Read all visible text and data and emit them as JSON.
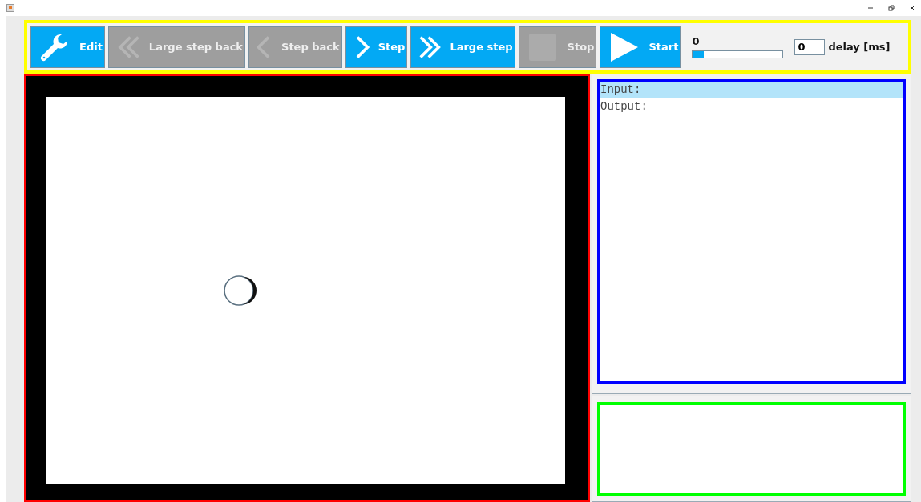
{
  "toolbar": {
    "buttons": [
      {
        "kind": "wrench",
        "label": "Edit",
        "disabled": false
      },
      {
        "kind": "double-left",
        "label": "Large step back",
        "disabled": true
      },
      {
        "kind": "left",
        "label": "Step back",
        "disabled": true
      },
      {
        "kind": "right",
        "label": "Step",
        "disabled": false
      },
      {
        "kind": "double-right",
        "label": "Large step",
        "disabled": false
      },
      {
        "kind": "square",
        "label": "Stop",
        "disabled": true
      },
      {
        "kind": "play",
        "label": "Start",
        "disabled": false
      }
    ],
    "progress": {
      "reading": "0",
      "level": 0.12
    },
    "delay": {
      "value": "0",
      "label": "delay [ms]"
    }
  },
  "io_list": [
    {
      "text": "Input:",
      "selected": true
    },
    {
      "text": "Output:",
      "selected": false
    }
  ]
}
